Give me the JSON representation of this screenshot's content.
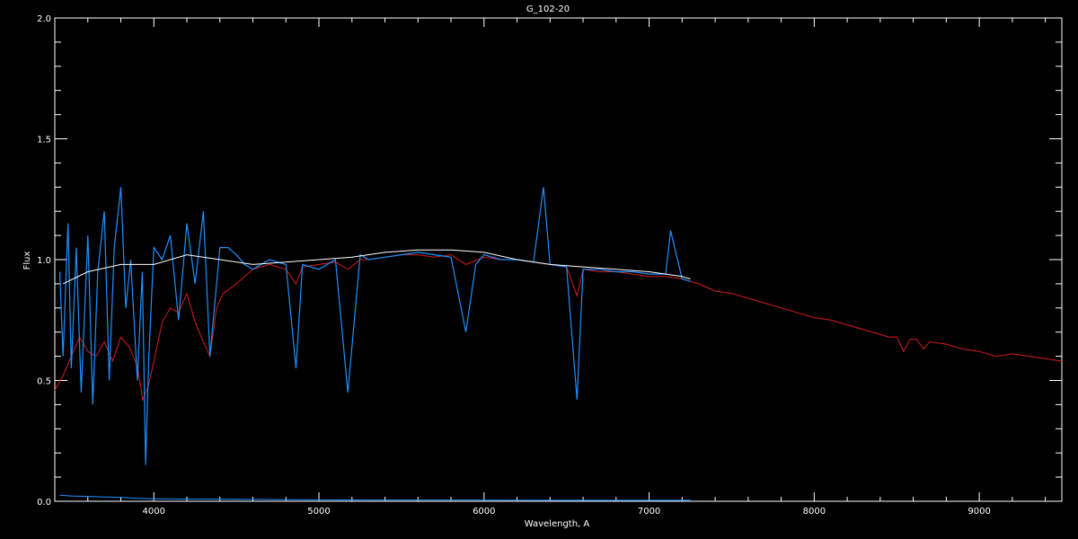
{
  "chart_data": {
    "type": "line",
    "title": "G_102-20",
    "xlabel": "Wavelength, A",
    "ylabel": "Flux",
    "xlim": [
      3400,
      9500
    ],
    "ylim": [
      0.0,
      2.0
    ],
    "xticks": [
      4000,
      5000,
      6000,
      7000,
      8000,
      9000
    ],
    "yticks": [
      0.0,
      0.5,
      1.0,
      1.5,
      2.0
    ],
    "xtick_labels": [
      "4000",
      "5000",
      "6000",
      "7000",
      "8000",
      "9000"
    ],
    "ytick_labels": [
      "0.0",
      "0.5",
      "1.0",
      "1.5",
      "2.0"
    ],
    "grid": false,
    "background": "#000000",
    "axis_color": "#ffffff",
    "series": [
      {
        "color": "#d41c1c",
        "x": [
          3400,
          3450,
          3500,
          3550,
          3600,
          3650,
          3700,
          3750,
          3800,
          3850,
          3900,
          3933,
          3968,
          4000,
          4050,
          4100,
          4150,
          4200,
          4250,
          4300,
          4340,
          4380,
          4420,
          4500,
          4600,
          4700,
          4800,
          4861,
          4900,
          5000,
          5100,
          5175,
          5250,
          5300,
          5400,
          5500,
          5600,
          5700,
          5800,
          5890,
          6000,
          6100,
          6200,
          6300,
          6400,
          6500,
          6563,
          6600,
          6700,
          6800,
          6900,
          7000,
          7100,
          7200,
          7300,
          7400,
          7500,
          7600,
          7700,
          7800,
          7900,
          8000,
          8100,
          8200,
          8300,
          8400,
          8450,
          8500,
          8542,
          8580,
          8620,
          8662,
          8700,
          8800,
          8900,
          9000,
          9100,
          9200,
          9300,
          9400,
          9500
        ],
        "y": [
          0.46,
          0.52,
          0.6,
          0.68,
          0.62,
          0.6,
          0.66,
          0.58,
          0.68,
          0.64,
          0.56,
          0.42,
          0.48,
          0.58,
          0.74,
          0.8,
          0.78,
          0.86,
          0.74,
          0.66,
          0.6,
          0.8,
          0.86,
          0.9,
          0.96,
          0.98,
          0.96,
          0.9,
          0.97,
          0.98,
          0.99,
          0.96,
          1.0,
          1.0,
          1.01,
          1.02,
          1.02,
          1.01,
          1.02,
          0.98,
          1.01,
          1.0,
          1.0,
          0.99,
          0.98,
          0.97,
          0.85,
          0.96,
          0.95,
          0.95,
          0.94,
          0.93,
          0.93,
          0.92,
          0.9,
          0.87,
          0.86,
          0.84,
          0.82,
          0.8,
          0.78,
          0.76,
          0.75,
          0.73,
          0.71,
          0.69,
          0.68,
          0.68,
          0.62,
          0.67,
          0.67,
          0.63,
          0.66,
          0.65,
          0.63,
          0.62,
          0.6,
          0.61,
          0.6,
          0.59,
          0.58
        ]
      },
      {
        "color": "#1e90ff",
        "x": [
          3430,
          3450,
          3480,
          3500,
          3530,
          3560,
          3600,
          3630,
          3660,
          3700,
          3730,
          3760,
          3800,
          3830,
          3860,
          3900,
          3930,
          3950,
          3970,
          4000,
          4050,
          4100,
          4150,
          4200,
          4250,
          4300,
          4340,
          4400,
          4450,
          4500,
          4550,
          4600,
          4700,
          4800,
          4861,
          4900,
          5000,
          5100,
          5175,
          5250,
          5300,
          5400,
          5500,
          5600,
          5700,
          5800,
          5890,
          5950,
          6000,
          6100,
          6200,
          6300,
          6360,
          6400,
          6500,
          6563,
          6600,
          6700,
          6800,
          6900,
          7000,
          7100,
          7130,
          7200,
          7250
        ],
        "y": [
          0.95,
          0.6,
          1.15,
          0.55,
          1.05,
          0.45,
          1.1,
          0.4,
          0.95,
          1.2,
          0.5,
          1.05,
          1.3,
          0.8,
          1.0,
          0.5,
          0.95,
          0.15,
          0.6,
          1.05,
          1.0,
          1.1,
          0.75,
          1.15,
          0.9,
          1.2,
          0.6,
          1.05,
          1.05,
          1.02,
          0.98,
          0.96,
          1.0,
          0.98,
          0.55,
          0.98,
          0.96,
          1.0,
          0.45,
          1.02,
          1.0,
          1.01,
          1.02,
          1.03,
          1.02,
          1.01,
          0.7,
          0.98,
          1.02,
          1.0,
          1.0,
          0.99,
          1.3,
          0.98,
          0.97,
          0.42,
          0.96,
          0.96,
          0.95,
          0.95,
          0.94,
          0.94,
          1.12,
          0.92,
          0.91
        ]
      },
      {
        "color": "#ffffff",
        "x": [
          3450,
          3600,
          3800,
          4000,
          4200,
          4400,
          4600,
          4800,
          5000,
          5200,
          5400,
          5600,
          5800,
          6000,
          6200,
          6400,
          6600,
          6800,
          7000,
          7200,
          7250
        ],
        "y": [
          0.9,
          0.95,
          0.98,
          0.98,
          1.02,
          1.0,
          0.98,
          0.99,
          1.0,
          1.01,
          1.03,
          1.04,
          1.04,
          1.03,
          1.0,
          0.98,
          0.97,
          0.96,
          0.95,
          0.93,
          0.92
        ]
      },
      {
        "color": "#1e90ff",
        "x": [
          3430,
          3500,
          3600,
          3700,
          3800,
          3900,
          4000,
          4500,
          5000,
          5500,
          6000,
          6500,
          7000,
          7250
        ],
        "y": [
          0.025,
          0.022,
          0.02,
          0.018,
          0.016,
          0.012,
          0.01,
          0.008,
          0.006,
          0.005,
          0.005,
          0.004,
          0.004,
          0.004
        ]
      }
    ]
  }
}
